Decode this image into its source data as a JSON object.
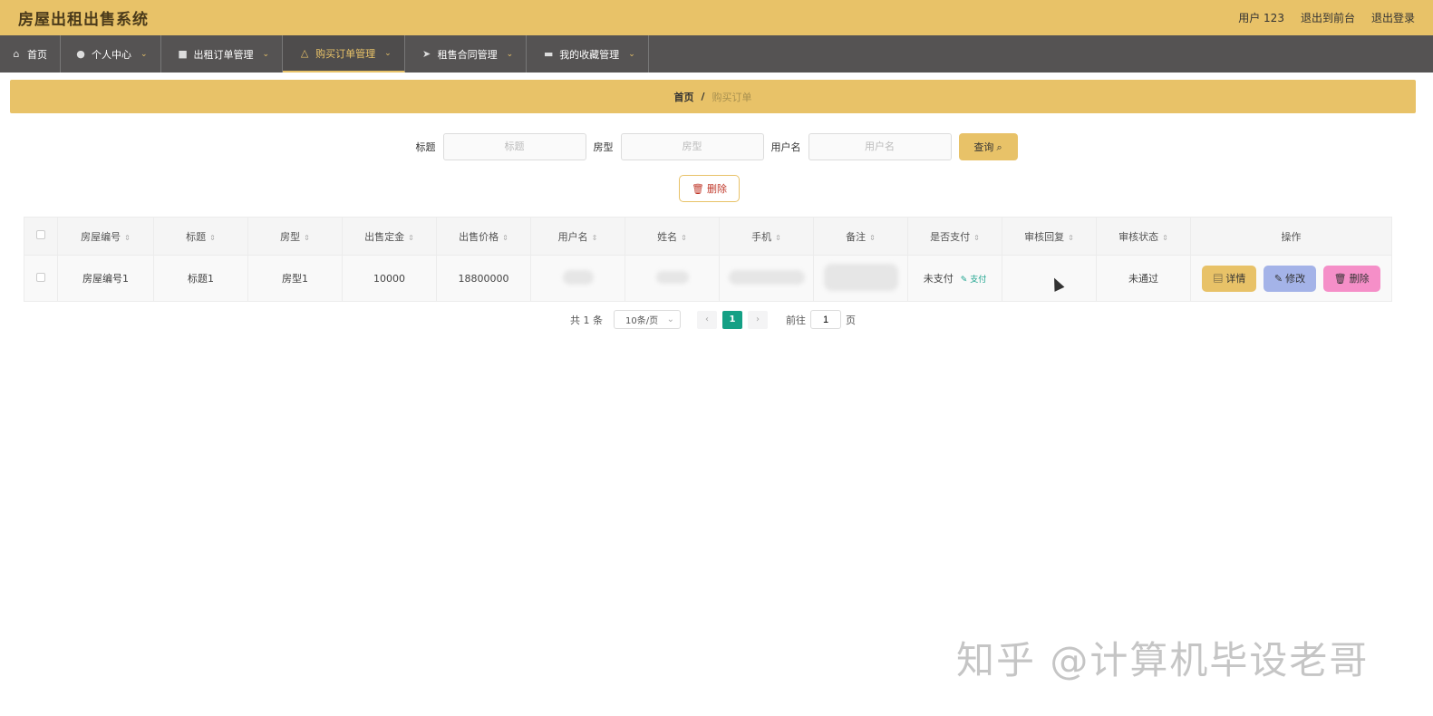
{
  "header": {
    "app_title": "房屋出租出售系统",
    "user_label": "用户 123",
    "front_label": "退出到前台",
    "logout_label": "退出登录"
  },
  "nav": {
    "items": [
      {
        "label": "首页",
        "icon": "home-icon"
      },
      {
        "label": "个人中心",
        "icon": "user-icon"
      },
      {
        "label": "出租订单管理",
        "icon": "briefcase-icon"
      },
      {
        "label": "购买订单管理",
        "icon": "bell-icon"
      },
      {
        "label": "租售合同管理",
        "icon": "send-icon"
      },
      {
        "label": "我的收藏管理",
        "icon": "monitor-icon"
      }
    ],
    "active_index": 3
  },
  "breadcrumb": {
    "home": "首页",
    "sep": "/",
    "current": "购买订单"
  },
  "search": {
    "title_label": "标题",
    "title_placeholder": "标题",
    "type_label": "房型",
    "type_placeholder": "房型",
    "username_label": "用户名",
    "username_placeholder": "用户名",
    "query_label": "查询 ⌕"
  },
  "toolbar": {
    "delete_label": "🗑 删除"
  },
  "table": {
    "columns": [
      "房屋编号",
      "标题",
      "房型",
      "出售定金",
      "出售价格",
      "用户名",
      "姓名",
      "手机",
      "备注",
      "是否支付",
      "审核回复",
      "审核状态",
      "操作"
    ],
    "rows": [
      {
        "house_no": "房屋编号1",
        "title": "标题1",
        "type": "房型1",
        "deposit": "10000",
        "price": "18800000",
        "paid": "未支付",
        "pay_link": "✎ 支付",
        "reply": "",
        "status": "未通过",
        "detail_label": "▤ 详情",
        "edit_label": "✎ 修改",
        "delete_label": "🗑 删除"
      }
    ]
  },
  "pager": {
    "total": "共 1 条",
    "page_size": "10条/页",
    "current_page": "1",
    "goto_label": "前往",
    "goto_value": "1",
    "page_unit": "页"
  },
  "watermark": "知乎 @计算机毕设老哥"
}
